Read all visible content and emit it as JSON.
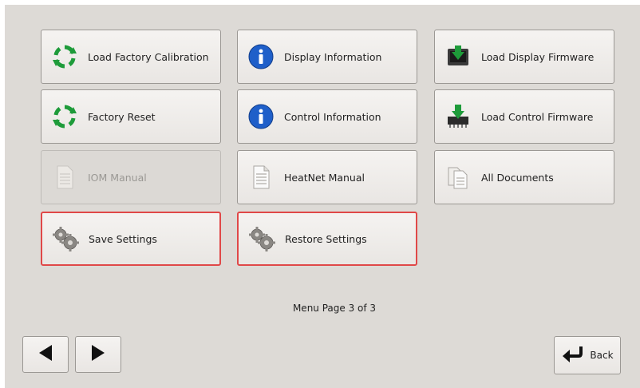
{
  "menu": {
    "buttons": [
      {
        "label": "Load Factory Calibration",
        "icon": "refresh-icon"
      },
      {
        "label": "Display Information",
        "icon": "info-icon"
      },
      {
        "label": "Load Display Firmware",
        "icon": "download-monitor-icon"
      },
      {
        "label": "Factory Reset",
        "icon": "refresh-icon"
      },
      {
        "label": "Control Information",
        "icon": "info-icon"
      },
      {
        "label": "Load Control Firmware",
        "icon": "download-chip-icon"
      },
      {
        "label": "IOM Manual",
        "icon": "document-icon",
        "state": "disabled"
      },
      {
        "label": "HeatNet Manual",
        "icon": "document-icon"
      },
      {
        "label": "All Documents",
        "icon": "documents-icon"
      },
      {
        "label": "Save Settings",
        "icon": "gears-icon",
        "state": "highlighted"
      },
      {
        "label": "Restore Settings",
        "icon": "gears-icon",
        "state": "highlighted"
      }
    ],
    "page_indicator": "Menu Page 3 of 3"
  },
  "navigation": {
    "prev_icon": "triangle-left-icon",
    "next_icon": "triangle-right-icon",
    "back_label": "Back",
    "back_icon": "return-arrow-icon"
  },
  "colors": {
    "background": "#dddad6",
    "highlight_border": "#e04848",
    "refresh_green": "#1e9b3a",
    "info_blue": "#1f5fc9"
  }
}
